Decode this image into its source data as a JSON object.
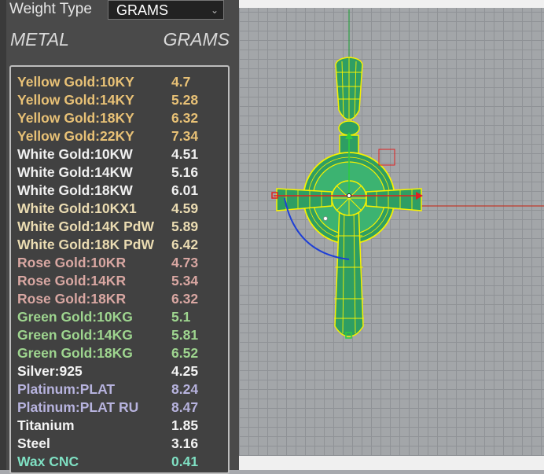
{
  "header": {
    "weight_type_label": "Weight Type",
    "weight_type_value": "GRAMS",
    "col_metal": "METAL",
    "col_grams": "GRAMS"
  },
  "colors": {
    "yellow": "#e8c176",
    "white": "#f0f0f0",
    "whiteTint": "#ebdcb2",
    "rose": "#d9a7a2",
    "green": "#9ed58f",
    "silver": "#f4f4f4",
    "platinum": "#b7b3de",
    "wax": "#7fe0c3",
    "model": "#f6f200",
    "modelFill": "#2e9e63"
  },
  "metals": [
    {
      "name": "Yellow Gold:10KY",
      "grams": "4.7",
      "color": "#e8c176"
    },
    {
      "name": "Yellow Gold:14KY",
      "grams": "5.28",
      "color": "#e8c176"
    },
    {
      "name": "Yellow Gold:18KY",
      "grams": "6.32",
      "color": "#e8c176"
    },
    {
      "name": "Yellow Gold:22KY",
      "grams": "7.34",
      "color": "#e8c176"
    },
    {
      "name": "White Gold:10KW",
      "grams": "4.51",
      "color": "#f0f0f0"
    },
    {
      "name": "White Gold:14KW",
      "grams": "5.16",
      "color": "#f0f0f0"
    },
    {
      "name": "White Gold:18KW",
      "grams": "6.01",
      "color": "#f0f0f0"
    },
    {
      "name": "White Gold:10KX1",
      "grams": "4.59",
      "color": "#ebdcb2"
    },
    {
      "name": "White Gold:14K PdW",
      "grams": "5.89",
      "color": "#ebdcb2"
    },
    {
      "name": "White Gold:18K PdW",
      "grams": "6.42",
      "color": "#ebdcb2"
    },
    {
      "name": "Rose Gold:10KR",
      "grams": "4.73",
      "color": "#d9a7a2"
    },
    {
      "name": "Rose Gold:14KR",
      "grams": "5.34",
      "color": "#d9a7a2"
    },
    {
      "name": "Rose Gold:18KR",
      "grams": "6.32",
      "color": "#d9a7a2"
    },
    {
      "name": "Green Gold:10KG",
      "grams": "5.1",
      "color": "#9ed58f"
    },
    {
      "name": "Green Gold:14KG",
      "grams": "5.81",
      "color": "#9ed58f"
    },
    {
      "name": "Green Gold:18KG",
      "grams": "6.52",
      "color": "#9ed58f"
    },
    {
      "name": "Silver:925",
      "grams": "4.25",
      "color": "#f4f4f4"
    },
    {
      "name": "Platinum:PLAT",
      "grams": "8.24",
      "color": "#b7b3de"
    },
    {
      "name": "Platinum:PLAT RU",
      "grams": "8.47",
      "color": "#b7b3de"
    },
    {
      "name": "Titanium",
      "grams": "1.85",
      "color": "#f4f4f4"
    },
    {
      "name": "Steel",
      "grams": "3.16",
      "color": "#f4f4f4"
    },
    {
      "name": "Wax  CNC",
      "grams": "0.41",
      "color": "#7fe0c3"
    }
  ],
  "icons": {
    "dropdown": "chevron-down-icon",
    "model": "celtic-cross-pendant-icon"
  }
}
